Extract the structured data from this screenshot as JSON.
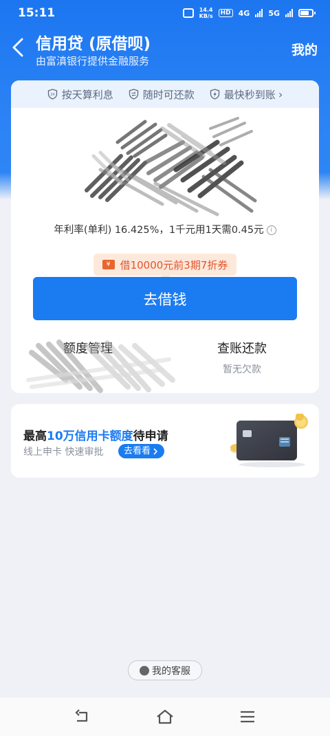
{
  "status_bar": {
    "time": "15:11",
    "speed_value": "14.4",
    "speed_unit": "KB/s",
    "hd": "HD",
    "net1": "4G",
    "net2": "5G"
  },
  "header": {
    "title": "信用贷 (原借呗)",
    "subtitle": "由富滇银行提供金融服务",
    "mine": "我的"
  },
  "features": [
    {
      "icon": "24h-shield-icon",
      "label": "按天算利息"
    },
    {
      "icon": "swap-icon",
      "label": "随时可还款"
    },
    {
      "icon": "lightning-icon",
      "label": "最快秒到账"
    }
  ],
  "rate_text": "年利率(单利) 16.425%，1千元用1天需0.45元",
  "coupon": {
    "icon_char": "¥",
    "label": "借10000元前3期7折券"
  },
  "borrow_button": "去借钱",
  "cells": {
    "left": {
      "label": "额度管理"
    },
    "right": {
      "label": "查账还款",
      "sub": "暂无欠款"
    }
  },
  "promo": {
    "title_prefix": "最高",
    "title_highlight": "10万信用卡额度",
    "title_suffix": "待申请",
    "subtitle": "线上申卡 快速审批",
    "button": "去看看"
  },
  "service_button": "我的客服",
  "colors": {
    "brand_blue": "#1b7bf1",
    "coupon_bg": "#fde9dc",
    "coupon_text": "#e2542b"
  }
}
